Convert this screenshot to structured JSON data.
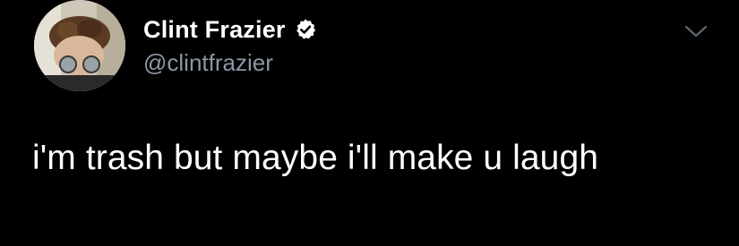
{
  "tweet": {
    "author": {
      "display_name": "Clint Frazier",
      "handle": "@clintfrazier",
      "verified": true,
      "avatar_icon": "profile-photo"
    },
    "text": "i'm trash but maybe i'll make u laugh",
    "menu_icon": "chevron-down-icon",
    "colors": {
      "background": "#000000",
      "name": "#ffffff",
      "handle": "#8b98a5",
      "text": "#ffffff",
      "verified_badge": "#ffffff"
    }
  }
}
